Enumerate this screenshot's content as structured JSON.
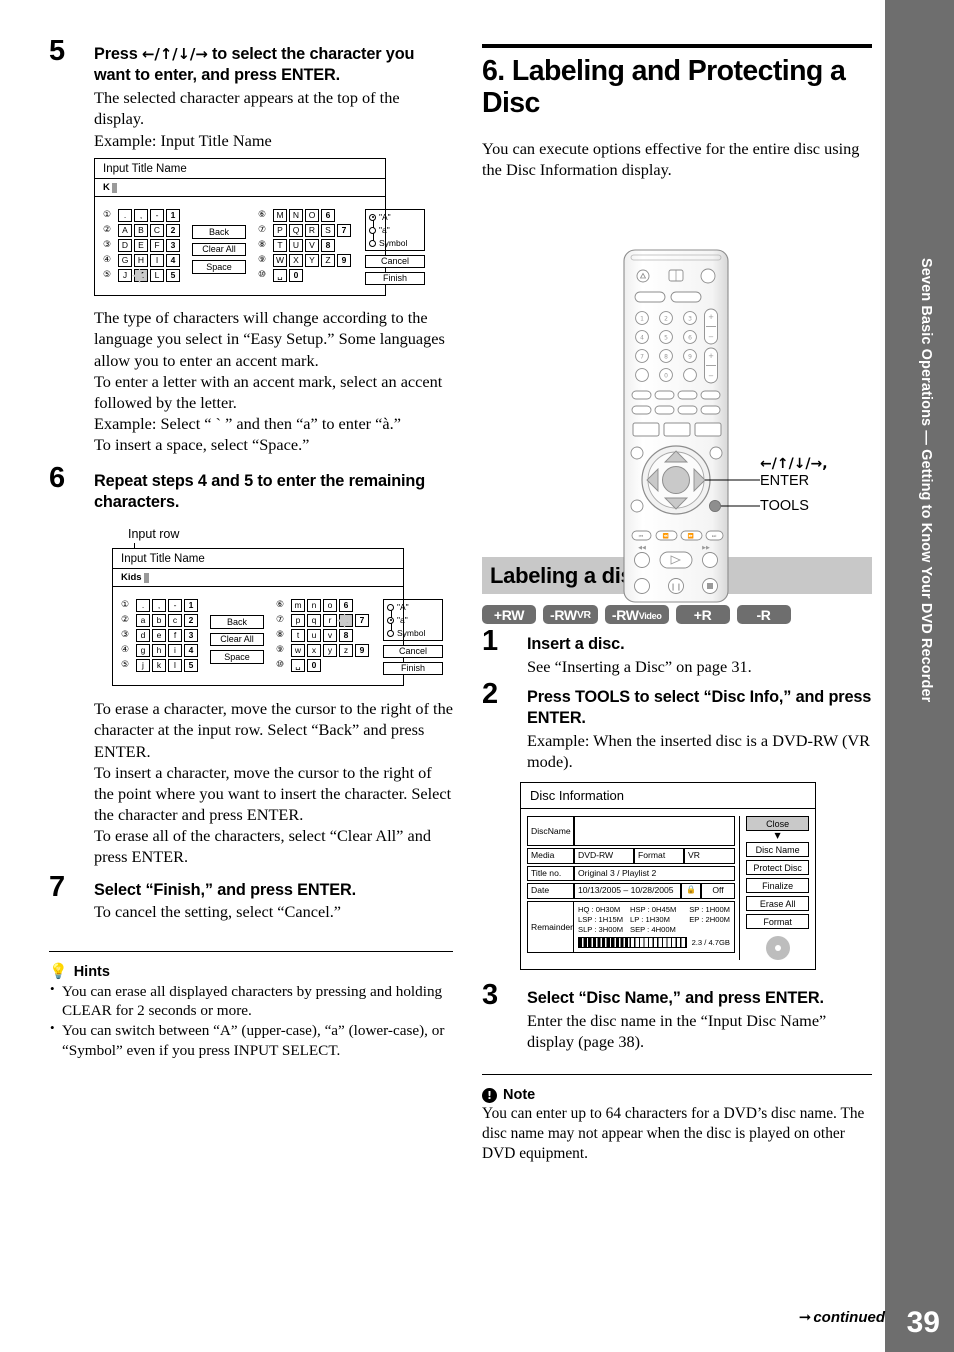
{
  "page": {
    "number": "39",
    "continued": "continued",
    "side_tab": "Seven Basic Operations — Getting to Know Your DVD Recorder"
  },
  "left_column": {
    "step5": {
      "num": "5",
      "title_pre": "Press ",
      "title_arrows": "←/↑/↓/→",
      "title_post": " to select the character you want to enter, and press ENTER.",
      "body": "The selected character appears at the top of the display.",
      "example": "Example: Input Title Name"
    },
    "step6": {
      "num": "6",
      "title": "Repeat steps 4 and 5 to enter the remaining characters.",
      "callout": "Input row",
      "body": "To erase a character, move the cursor to the right of the character at the input row. Select “Back” and press ENTER.\nTo insert a character, move the cursor to the right of the point where you want to insert the character. Select the character and press ENTER.\nTo erase all of the characters, select “Clear All” and press ENTER."
    },
    "step7": {
      "num": "7",
      "title": "Select “Finish,” and press ENTER.",
      "body": "To cancel the setting, select “Cancel.”"
    },
    "after_kb_text": "The type of characters will change according to the language you select in “Easy Setup.” Some languages allow you to enter an accent mark.\nTo enter a letter with an accent mark, select an accent followed by the letter.\nExample: Select “ ` ” and then “a” to enter “à.”\nTo insert a space, select “Space.”",
    "hints": {
      "heading": "Hints",
      "icon": "bulb-icon",
      "items": [
        "You can erase all displayed characters by pressing and holding CLEAR for 2 seconds or more.",
        "You can switch between “A” (upper-case), “a” (lower-case), or “Symbol” even if you press INPUT SELECT."
      ]
    }
  },
  "keyboard_upper": {
    "title": "Input Title Name",
    "input_value": "K",
    "numbers": [
      "①",
      "②",
      "③",
      "④",
      "⑤",
      "⑥",
      "⑦",
      "⑧",
      "⑨",
      "⑩"
    ],
    "left_rows": [
      [
        ".",
        ",",
        "-",
        "1"
      ],
      [
        "A",
        "B",
        "C",
        "2"
      ],
      [
        "D",
        "E",
        "F",
        "3"
      ],
      [
        "G",
        "H",
        "I",
        "4"
      ],
      [
        "J",
        "K",
        "L",
        "5"
      ]
    ],
    "right_rows": [
      [
        "M",
        "N",
        "O",
        "6"
      ],
      [
        "P",
        "Q",
        "R",
        "S",
        "7"
      ],
      [
        "T",
        "U",
        "V",
        "8"
      ],
      [
        "W",
        "X",
        "Y",
        "Z",
        "9"
      ],
      [
        "␣",
        "0"
      ]
    ],
    "mid_buttons": [
      "Back",
      "Clear All",
      "Space"
    ],
    "modes": [
      "\"A\"",
      "\"a\"",
      "Symbol"
    ],
    "selected_mode": "\"A\"",
    "actions": [
      "Cancel",
      "Finish"
    ],
    "cursor_key": "K"
  },
  "keyboard_lower": {
    "title": "Input Title Name",
    "input_value": "Kids",
    "numbers": [
      "①",
      "②",
      "③",
      "④",
      "⑤",
      "⑥",
      "⑦",
      "⑧",
      "⑨",
      "⑩"
    ],
    "left_rows": [
      [
        ".",
        ",",
        "-",
        "1"
      ],
      [
        "a",
        "b",
        "c",
        "2"
      ],
      [
        "d",
        "e",
        "f",
        "3"
      ],
      [
        "g",
        "h",
        "i",
        "4"
      ],
      [
        "j",
        "k",
        "l",
        "5"
      ]
    ],
    "right_rows": [
      [
        "m",
        "n",
        "o",
        "6"
      ],
      [
        "p",
        "q",
        "r",
        "s",
        "7"
      ],
      [
        "t",
        "u",
        "v",
        "8"
      ],
      [
        "w",
        "x",
        "y",
        "z",
        "9"
      ],
      [
        "␣",
        "0"
      ]
    ],
    "mid_buttons": [
      "Back",
      "Clear All",
      "Space"
    ],
    "modes": [
      "\"A\"",
      "\"a\"",
      "Symbol"
    ],
    "selected_mode": "\"a\"",
    "actions": [
      "Cancel",
      "Finish"
    ],
    "cursor_key": "s"
  },
  "right_column": {
    "section_title": "6. Labeling and Protecting a Disc",
    "section_intro": "You can execute options effective for the entire disc using the Disc Information display.",
    "subsection_title": "Labeling a disc",
    "badges": [
      "+RW",
      "-RWVR",
      "-RWVideo",
      "+R",
      "-R"
    ],
    "remote_labels": {
      "arrows": "←/↑/↓/→,",
      "enter": "ENTER",
      "tools": "TOOLS"
    },
    "step1": {
      "num": "1",
      "title": "Insert a disc.",
      "body": "See “Inserting a Disc” on page 31."
    },
    "step2": {
      "num": "2",
      "title": "Press TOOLS to select “Disc Info,” and press ENTER.",
      "body": "Example: When the inserted disc is a DVD-RW (VR mode)."
    },
    "step3": {
      "num": "3",
      "title": "Select “Disc Name,” and press ENTER.",
      "body": "Enter the disc name in the “Input Disc Name” display (page 38)."
    },
    "note": {
      "heading": "Note",
      "icon": "note-icon",
      "text": "You can enter up to 64 characters for a DVD’s disc name. The disc name may not appear when the disc is played on other DVD equipment."
    }
  },
  "disc_info": {
    "title": "Disc Information",
    "disc_name_label": "DiscName",
    "disc_name_value": "",
    "media_label": "Media",
    "media_value": "DVD-RW",
    "format_label": "Format",
    "format_value": "VR",
    "title_no_label": "Title no.",
    "title_no_value": "Original 3 / Playlist 2",
    "date_label": "Date",
    "date_value": "10/13/2005 – 10/28/2005",
    "lock_icon": "lock-icon",
    "protect_value": "Off",
    "remainder_label": "Remainder",
    "remainder": [
      "HQ : 0H30M",
      "HSP : 0H45M",
      "SP : 1H00M",
      "LSP : 1H15M",
      "LP : 1H30M",
      "EP : 2H00M",
      "SLP : 3H00M",
      "SEP : 4H00M",
      ""
    ],
    "capacity": "2.3 / 4.7GB",
    "buttons": [
      "Close",
      "Disc Name",
      "Protect Disc",
      "Finalize",
      "Erase All",
      "Format"
    ],
    "selected_button": "Close",
    "disc_icon": "disc-icon"
  }
}
